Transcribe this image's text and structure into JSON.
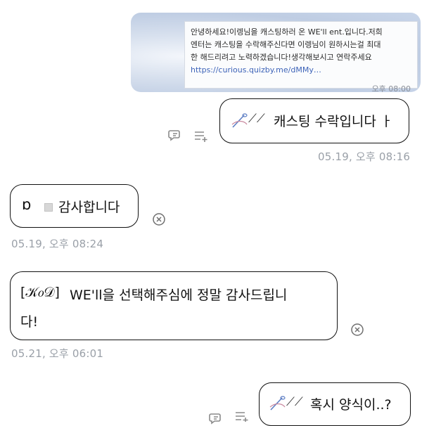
{
  "shared_card": {
    "lines": [
      "안녕하세요!이렝님을 캐스팅하러 온 WE'll ent.입니다.저희",
      "엔터는 캐스팅을 수락해주신다면 이렝님이 원하시는걸 최대",
      "한 해드리려고 노력하겠습니다!생각해보시고 연락주세요"
    ],
    "link": "https://curious.quizby.me/dMMy…",
    "time": "오후 08:00"
  },
  "messages": [
    {
      "prefix": "⟋⟋",
      "text": "캐스팅 수락입니다 ㅏ",
      "time": "05.19, 오후 08:16"
    },
    {
      "prefix": "ɒ",
      "text": "감사합니다",
      "time": "05.19, 오후 08:24"
    },
    {
      "tag": "[𝒦𝑜𝒟]",
      "text_line1": "WE'll을 선택해주심에 정말 감사드립니",
      "text_line2": "다!",
      "time": "05.21, 오후 06:01"
    },
    {
      "prefix": "⟋⟋",
      "text": "혹시 양식이..?"
    }
  ],
  "colors": {
    "link": "#3d63b8",
    "timestamp": "#9aa0a8",
    "border": "#111111",
    "icon": "#8a8a8a"
  }
}
